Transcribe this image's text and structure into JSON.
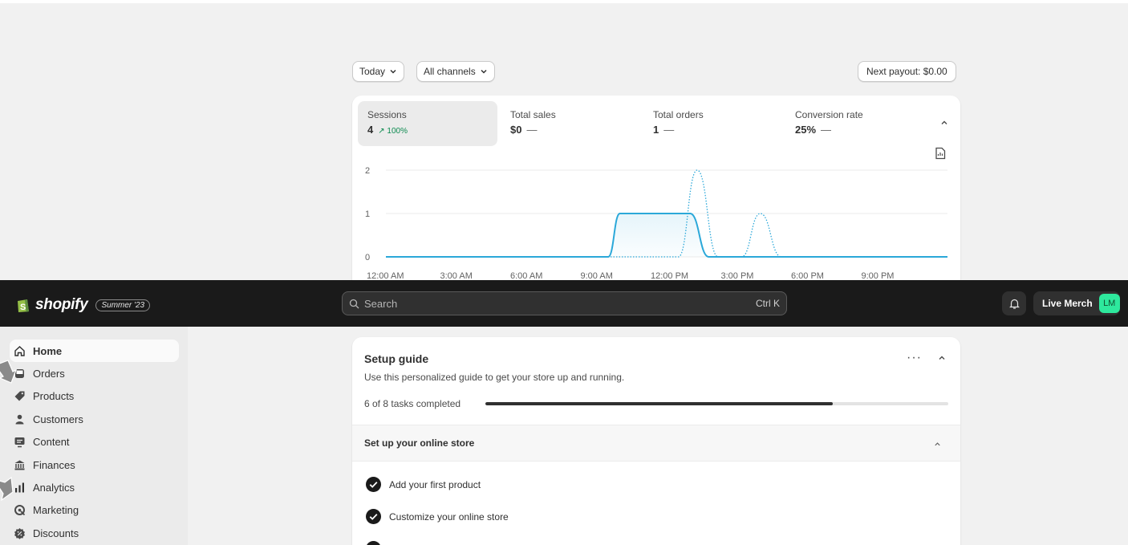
{
  "filters": {
    "date_label": "Today",
    "channels_label": "All channels",
    "payout_label": "Next payout: $0.00"
  },
  "metrics": [
    {
      "label": "Sessions",
      "value": "4",
      "trend": "↗ 100%"
    },
    {
      "label": "Total sales",
      "value": "$0",
      "trend": "—"
    },
    {
      "label": "Total orders",
      "value": "1",
      "trend": "—"
    },
    {
      "label": "Conversion rate",
      "value": "25%",
      "trend": "—"
    }
  ],
  "chart_data": {
    "type": "line",
    "x": [
      "12:00 AM",
      "3:00 AM",
      "6:00 AM",
      "9:00 AM",
      "12:00 PM",
      "3:00 PM",
      "6:00 PM",
      "9:00 PM"
    ],
    "ylim": [
      0,
      2
    ],
    "yticks": [
      "2",
      "1",
      "0"
    ],
    "series": [
      {
        "style": "solid",
        "color": "#2ba8d9",
        "points": [
          [
            0,
            0
          ],
          [
            9.5,
            0
          ],
          [
            10,
            1
          ],
          [
            13,
            1
          ],
          [
            13.8,
            0
          ],
          [
            24,
            0
          ]
        ]
      },
      {
        "style": "dotted",
        "color": "#2ba8d9",
        "points": [
          [
            0,
            0
          ],
          [
            12.5,
            0
          ],
          [
            13.3,
            2
          ],
          [
            14.2,
            0
          ],
          [
            15.2,
            0
          ],
          [
            16,
            1
          ],
          [
            16.9,
            0
          ],
          [
            24,
            0
          ]
        ]
      }
    ]
  },
  "topbar": {
    "brand": "shopify",
    "season_badge": "Summer '23",
    "search_placeholder": "Search",
    "search_shortcut": "Ctrl K",
    "store_name": "Live Merch",
    "store_initials": "LM"
  },
  "sidebar": {
    "items": [
      {
        "label": "Home"
      },
      {
        "label": "Orders"
      },
      {
        "label": "Products"
      },
      {
        "label": "Customers"
      },
      {
        "label": "Content"
      },
      {
        "label": "Finances"
      },
      {
        "label": "Analytics"
      },
      {
        "label": "Marketing"
      },
      {
        "label": "Discounts"
      }
    ]
  },
  "setup_guide": {
    "title": "Setup guide",
    "subtitle": "Use this personalized guide to get your store up and running.",
    "progress_label": "6 of 8 tasks completed",
    "progress_fraction": 0.75,
    "more_label": "···",
    "section_title": "Set up your online store",
    "tasks": [
      {
        "label": "Add your first product"
      },
      {
        "label": "Customize your online store"
      }
    ]
  }
}
